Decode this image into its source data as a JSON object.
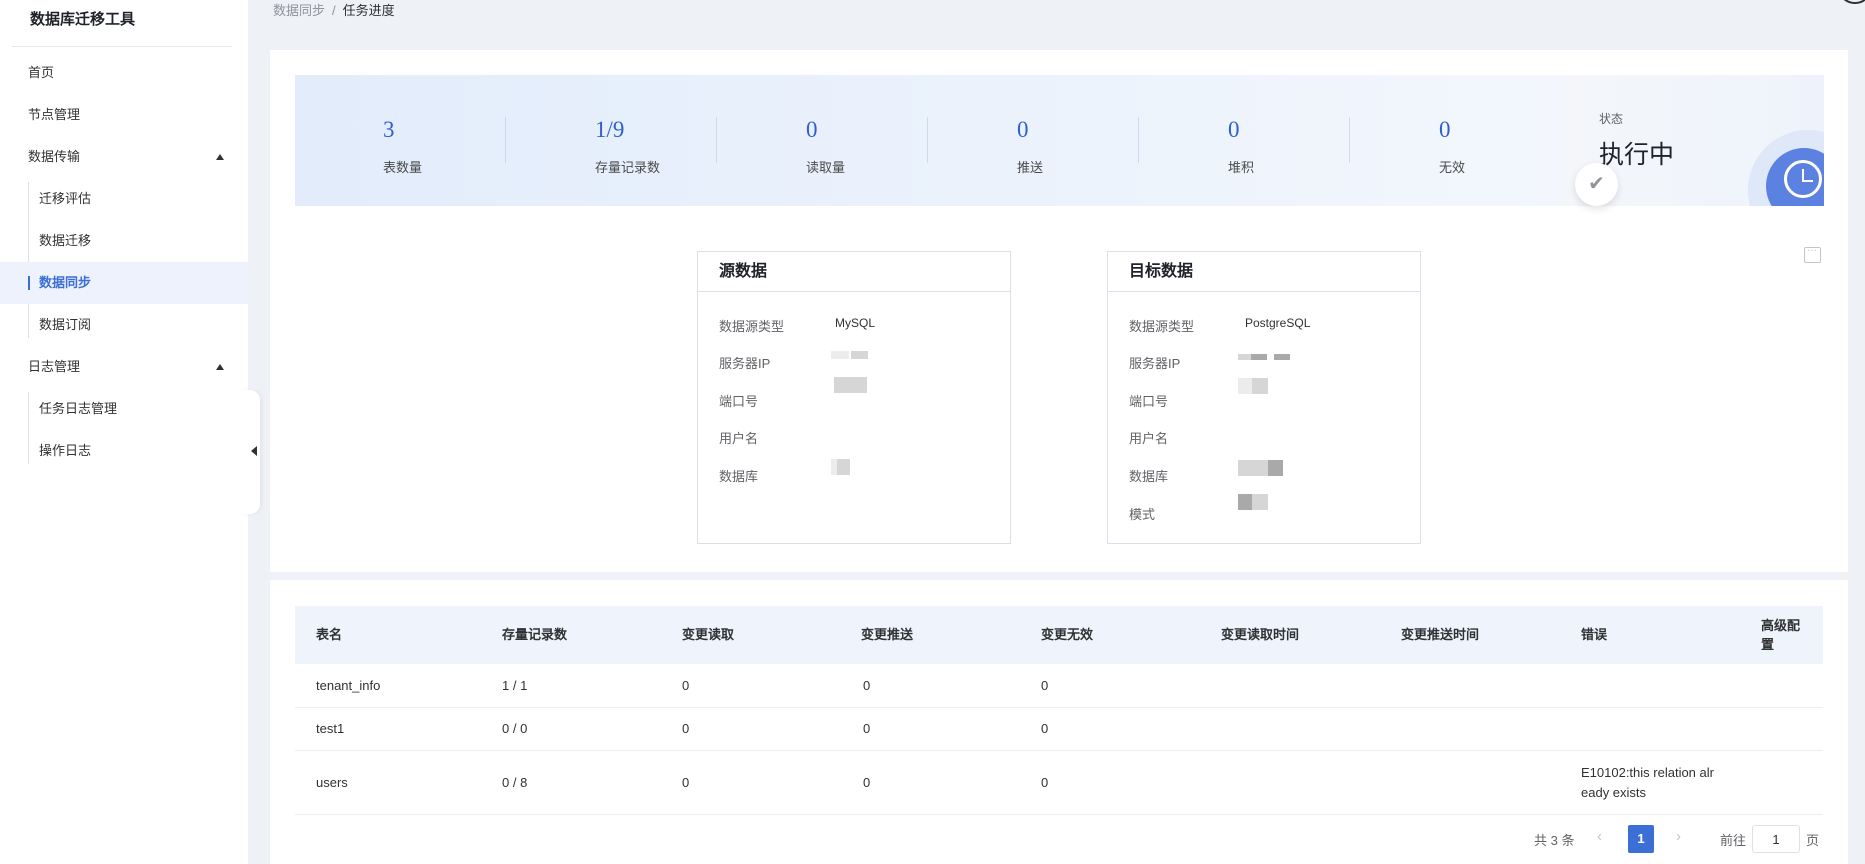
{
  "app": {
    "title": "数据库迁移工具"
  },
  "sidebar": {
    "items": [
      {
        "label": "首页"
      },
      {
        "label": "节点管理"
      },
      {
        "label": "数据传输"
      },
      {
        "label": "迁移评估"
      },
      {
        "label": "数据迁移"
      },
      {
        "label": "数据同步"
      },
      {
        "label": "数据订阅"
      },
      {
        "label": "日志管理"
      },
      {
        "label": "任务日志管理"
      },
      {
        "label": "操作日志"
      }
    ]
  },
  "breadcrumb": {
    "parent": "数据同步",
    "separator": "/",
    "current": "任务进度"
  },
  "stats": [
    {
      "value": "3",
      "label": "表数量"
    },
    {
      "value": "1/9",
      "label": "存量记录数"
    },
    {
      "value": "0",
      "label": "读取量"
    },
    {
      "value": "0",
      "label": "推送"
    },
    {
      "value": "0",
      "label": "堆积"
    },
    {
      "value": "0",
      "label": "无效"
    }
  ],
  "status": {
    "label": "状态",
    "value": "执行中"
  },
  "source": {
    "title": "源数据",
    "type_label": "数据源类型",
    "type_value": "MySQL",
    "ip_label": "服务器IP",
    "port_label": "端口号",
    "user_label": "用户名",
    "db_label": "数据库"
  },
  "target": {
    "title": "目标数据",
    "type_label": "数据源类型",
    "type_value": "PostgreSQL",
    "ip_label": "服务器IP",
    "port_label": "端口号",
    "user_label": "用户名",
    "db_label": "数据库",
    "schema_label": "模式"
  },
  "table": {
    "columns": [
      "表名",
      "存量记录数",
      "变更读取",
      "变更推送",
      "变更无效",
      "变更读取时间",
      "变更推送时间",
      "错误",
      "高级配置"
    ],
    "rows": [
      {
        "name": "tenant_info",
        "stock": "1 / 1",
        "read": "0",
        "push": "0",
        "invalid": "0",
        "error": ""
      },
      {
        "name": "test1",
        "stock": "0 / 0",
        "read": "0",
        "push": "0",
        "invalid": "0",
        "error": ""
      },
      {
        "name": "users",
        "stock": "0 / 8",
        "read": "0",
        "push": "0",
        "invalid": "0",
        "error": "E10102:this relation already exists"
      }
    ]
  },
  "pagination": {
    "total_text": "共 3 条",
    "prev": "‹",
    "next": "›",
    "current_page": "1",
    "goto_label": "前往",
    "goto_value": "1",
    "unit": "页"
  }
}
